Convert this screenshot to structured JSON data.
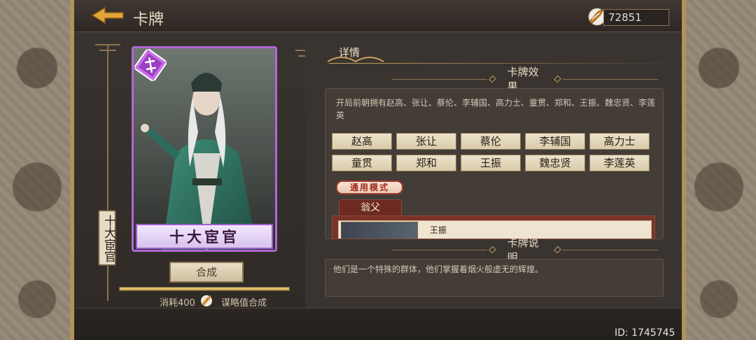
{
  "header": {
    "title": "卡牌",
    "currency_amount": "72851"
  },
  "card": {
    "name": "十大宦官",
    "side_tag": "十大宦官",
    "compose_label": "合成",
    "cost_prefix": "消耗400",
    "cost_suffix": "谋略值合成",
    "progress": 1.0
  },
  "detail": {
    "tab_label": "详情",
    "effect_title": "卡牌效果",
    "effect_description": "开局前朝拥有赵高、张让、蔡伦、李辅国、高力士、童贯、郑和、王振、魏忠贤、李莲英",
    "names": [
      "赵高",
      "张让",
      "蔡伦",
      "李辅国",
      "高力士",
      "童贯",
      "郑和",
      "王振",
      "魏忠贤",
      "李莲英"
    ],
    "mode_badge": "通用模式",
    "sub_tab": "翁父",
    "sub_entry_name": "王振",
    "explain_title": "卡牌说明",
    "explain_text": "他们是一个特殊的群体，他们掌握着烟火般虚无的辉煌。"
  },
  "footer": {
    "id_text": "ID: 1745745"
  },
  "colors": {
    "card_border": "#b267d6",
    "gold_accent": "#c8a35e",
    "mode_red": "#a32a1b"
  }
}
